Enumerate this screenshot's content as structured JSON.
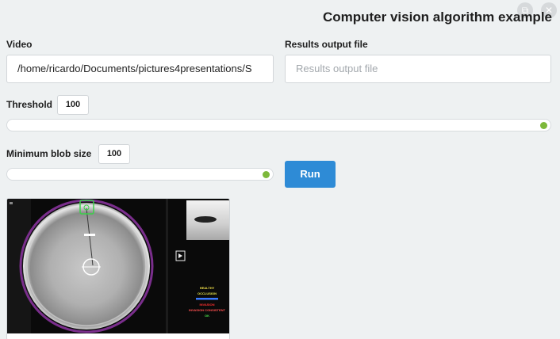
{
  "window": {
    "title": "Computer vision algorithm example",
    "detach_icon": "detach-icon",
    "close_icon": "close-icon"
  },
  "video": {
    "label": "Video",
    "value": "/home/ricardo/Documents/pictures4presentations/S"
  },
  "results": {
    "label": "Results output file",
    "placeholder": "Results output file"
  },
  "threshold": {
    "label": "Threshold",
    "value": "100",
    "slider_fraction": 1.0
  },
  "min_blob": {
    "label": "Minimum blob size",
    "value": "100",
    "slider_fraction": 1.0
  },
  "run_button": {
    "label": "Run"
  },
  "preview": {
    "legend": [
      "HEALTHY",
      "OCCLUSION",
      "",
      "INVASION",
      "INVASION CONSISTENT",
      "OK"
    ],
    "legend_colors": [
      "#f5e34a",
      "#e6e64a",
      "#3a7bff",
      "#ff3030",
      "#ff5050",
      "#4adf4a"
    ],
    "ring_color": "#7a2e8c",
    "marker_color": "#3bd14a"
  }
}
